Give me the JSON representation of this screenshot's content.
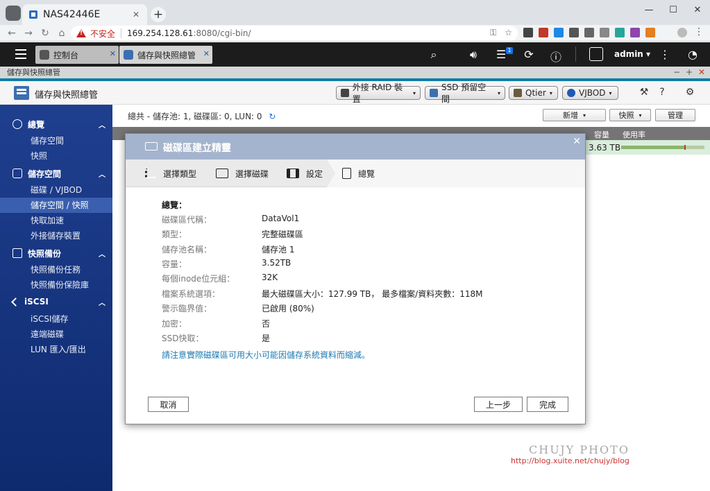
{
  "browser": {
    "tab_title": "NAS42446E",
    "tab_close": "✕",
    "new_tab": "+",
    "insecure_label": "不安全",
    "url_host": "169.254.128.61",
    "url_rest": ":8080/cgi-bin/",
    "minimize": "—",
    "maximize": "☐",
    "close": "✕"
  },
  "qts": {
    "tabs": [
      {
        "label": "控制台",
        "close": "✕"
      },
      {
        "label": "儲存與快照總管",
        "close": "✕"
      }
    ],
    "notification_count": "1",
    "user": "admin ▾"
  },
  "app": {
    "window_title": "儲存與快照總管",
    "window_controls": [
      "−",
      "+",
      "✕"
    ],
    "name": "儲存與快照總管",
    "header_buttons": [
      "外接 RAID 裝置",
      "SSD 預留空間",
      "Qtier",
      "VJBOD"
    ],
    "caret": "▾"
  },
  "sidebar": {
    "groups": [
      {
        "label": "總覽",
        "items": [
          "儲存空間",
          "快照"
        ]
      },
      {
        "label": "儲存空間",
        "items": [
          "磁碟 / VJBOD",
          "儲存空間 / 快照",
          "快取加速",
          "外接儲存裝置"
        ]
      },
      {
        "label": "快照備份",
        "items": [
          "快照備份任務",
          "快照備份保險庫"
        ]
      },
      {
        "label": "iSCSI",
        "items": [
          "iSCSI儲存",
          "遠端磁碟",
          "LUN 匯入/匯出"
        ]
      }
    ],
    "chevron": "︿"
  },
  "main": {
    "summary": "總共 - 儲存池: 1, 磁碟區: 0, LUN: 0",
    "refresh": "↻",
    "buttons": [
      {
        "label": "新增",
        "caret": "▾"
      },
      {
        "label": "快照",
        "caret": "▾"
      },
      {
        "label": "管理",
        "caret": ""
      }
    ],
    "columns": [
      "容量",
      "使用率"
    ],
    "row": {
      "capacity": "3.63 TB",
      "usage_fraction": 0.76
    }
  },
  "wizard": {
    "title": "磁碟區建立精靈",
    "close": "✕",
    "steps": [
      "選擇類型",
      "選擇磁碟",
      "設定",
      "總覽"
    ],
    "section_title": "總覽：",
    "fields": [
      {
        "label": "磁碟區代稱：",
        "value": "DataVol1"
      },
      {
        "label": "類型：",
        "value": "完整磁碟區"
      },
      {
        "label": "儲存池名稱：",
        "value": "儲存池 1"
      },
      {
        "label": "容量：",
        "value": "3.52TB"
      },
      {
        "label": "每個inode位元組：",
        "value": "32K"
      },
      {
        "label": "檔案系統選項：",
        "value": "最大磁碟區大小：127.99 TB， 最多檔案/資料夾數：118M"
      },
      {
        "label": "警示臨界值：",
        "value": "已啟用 (80%)"
      },
      {
        "label": "加密：",
        "value": "否"
      },
      {
        "label": "SSD快取：",
        "value": "是"
      }
    ],
    "note": "請注意實際磁碟區可用大小可能因儲存系統資料而縮減。",
    "cancel": "取消",
    "back": "上一步",
    "finish": "完成"
  },
  "watermark": {
    "title": "CHUJY PHOTO",
    "url": "http://blog.xuite.net/chujy/blog"
  }
}
